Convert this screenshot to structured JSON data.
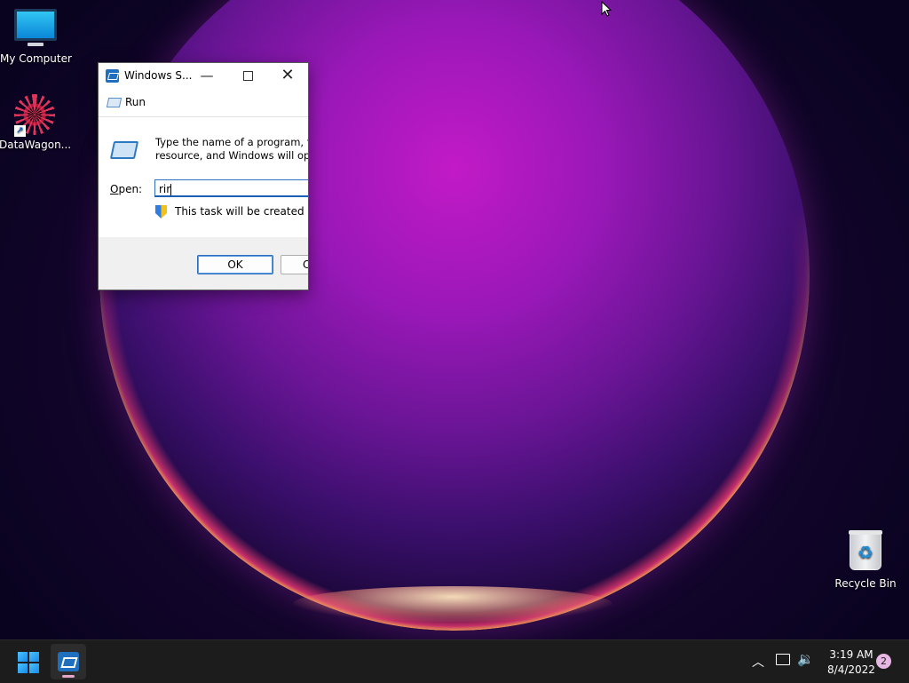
{
  "desktop": {
    "icons": [
      {
        "label": "My Computer"
      },
      {
        "label": "DataWagon..."
      },
      {
        "label": "Recycle Bin"
      }
    ]
  },
  "dialog": {
    "title": "Windows S...",
    "header_label": "Run",
    "description_line1": "Type the name of a program, fold",
    "description_line2": "resource, and Windows will open",
    "open_label": "Open:",
    "open_value": "rir",
    "shield_text": "This task will be created with",
    "ok_label": "OK",
    "cancel_label": "C"
  },
  "taskbar": {
    "time": "3:19 AM",
    "date": "8/4/2022",
    "notification_count": "2"
  },
  "colors": {
    "accent": "#1f6fbf",
    "taskbar": "#1c1c1c",
    "notification_badge": "#e7b7e3"
  }
}
